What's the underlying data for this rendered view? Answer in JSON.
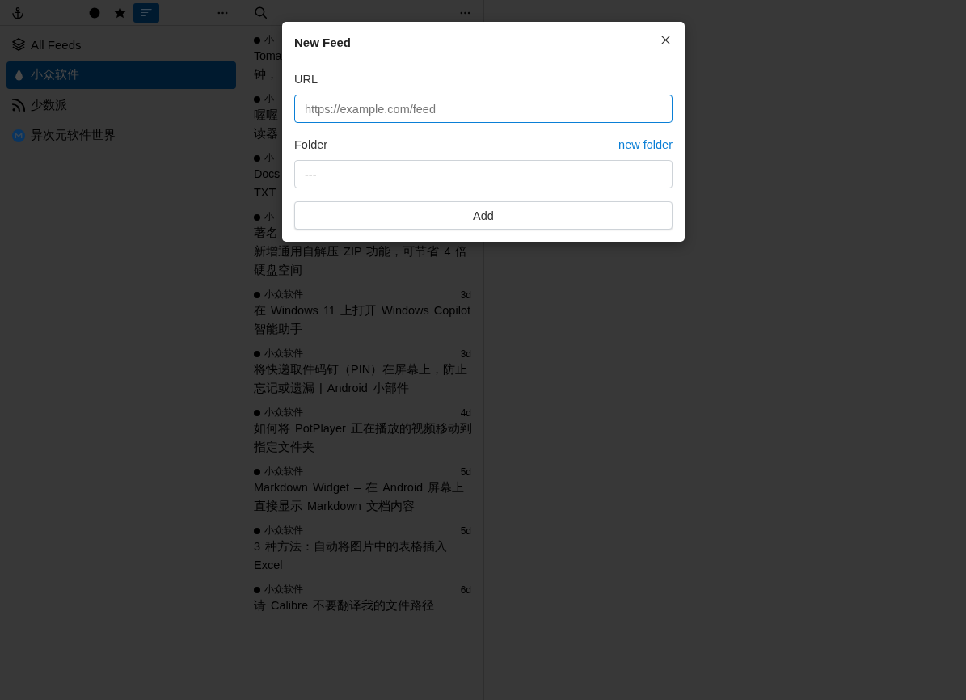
{
  "sidebar": {
    "toolbar": {
      "filters": [
        {
          "kind": "unread",
          "selected": false
        },
        {
          "kind": "starred",
          "selected": false
        },
        {
          "kind": "all",
          "selected": true
        }
      ]
    },
    "items": [
      {
        "kind": "all",
        "label": "All Feeds",
        "selected": false
      },
      {
        "kind": "drop",
        "label": "小众软件",
        "selected": true
      },
      {
        "kind": "rss",
        "label": "少数派",
        "selected": false
      },
      {
        "kind": "disc",
        "label": "异次元软件世界",
        "selected": false
      }
    ]
  },
  "articles": [
    {
      "kind": "clipped",
      "unread": true,
      "source": "小",
      "title_parts": [
        "Toma",
        "钟，"
      ]
    },
    {
      "kind": "clipped",
      "unread": true,
      "source": "小",
      "title_parts": [
        "喔喔",
        "读器"
      ]
    },
    {
      "kind": "clipped",
      "unread": true,
      "source": "小",
      "title_parts": [
        "Docs",
        "TXT"
      ]
    },
    {
      "kind": "clipped",
      "unread": true,
      "source": "小",
      "title_parts": [
        "著名",
        "新增通用自解压 ZIP 功能，可节省 4 倍硬盘空间"
      ]
    },
    {
      "kind": "full",
      "unread": true,
      "source": "小众软件",
      "time": "3d",
      "title": "在 Windows 11 上打开 Windows Copilot 智能助手"
    },
    {
      "kind": "full",
      "unread": true,
      "source": "小众软件",
      "time": "3d",
      "title": "将快递取件码钉（PIN）在屏幕上，防止忘记或遗漏 | Android 小部件"
    },
    {
      "kind": "full",
      "unread": true,
      "source": "小众软件",
      "time": "4d",
      "title": "如何将 PotPlayer 正在播放的视频移动到指定文件夹"
    },
    {
      "kind": "full",
      "unread": true,
      "source": "小众软件",
      "time": "5d",
      "title": "Markdown Widget – 在 Android 屏幕上直接显示 Markdown 文档内容"
    },
    {
      "kind": "full",
      "unread": true,
      "source": "小众软件",
      "time": "5d",
      "title": "3 种方法：自动将图片中的表格插入 Excel"
    },
    {
      "kind": "full",
      "unread": true,
      "source": "小众软件",
      "time": "6d",
      "title": "请 Calibre 不要翻译我的文件路径"
    }
  ],
  "dialog": {
    "title": "New Feed",
    "url_field": {
      "label": "URL",
      "placeholder": "https://example.com/feed",
      "focused": true
    },
    "folder_field": {
      "label": "Folder",
      "link": "new folder",
      "value": "---",
      "focused": false
    },
    "add_button": {
      "label": "Add"
    }
  }
}
